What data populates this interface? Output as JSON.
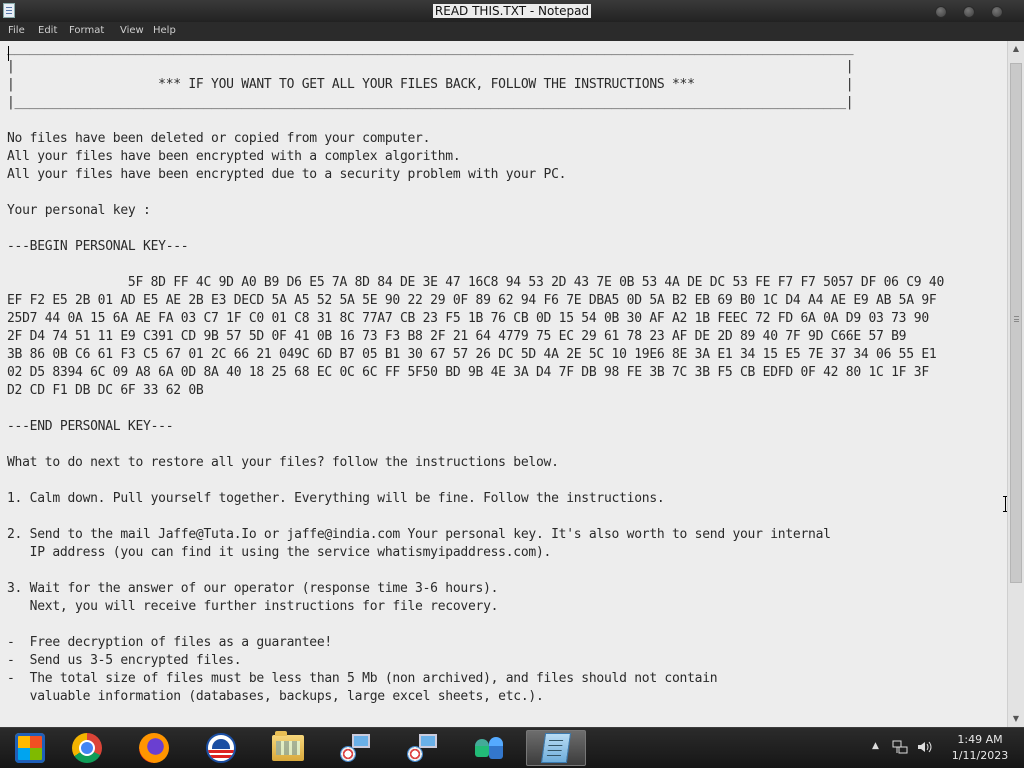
{
  "window": {
    "title": "READ THIS.TXT - Notepad",
    "icon": "notepad-icon"
  },
  "menu": [
    "File",
    "Edit",
    "Format",
    "View",
    "Help"
  ],
  "document": {
    "lines": [
      "________________________________________________________________________________________________________________",
      "|                                                                                                              |",
      "|                   *** IF YOU WANT TO GET ALL YOUR FILES BACK, FOLLOW THE INSTRUCTIONS ***                    |",
      "|______________________________________________________________________________________________________________|",
      "",
      "No files have been deleted or copied from your computer.",
      "All your files have been encrypted with a complex algorithm.",
      "All your files have been encrypted due to a security problem with your PC.",
      "",
      "Your personal key :",
      "",
      "---BEGIN PERSONAL KEY---",
      "",
      "                5F 8D FF 4C 9D A0 B9 D6 E5 7A 8D 84 DE 3E 47 16C8 94 53 2D 43 7E 0B 53 4A DE DC 53 FE F7 F7 5057 DF 06 C9 40",
      "EF F2 E5 2B 01 AD E5 AE 2B E3 DECD 5A A5 52 5A 5E 90 22 29 0F 89 62 94 F6 7E DBA5 0D 5A B2 EB 69 B0 1C D4 A4 AE E9 AB 5A 9F",
      "25D7 44 0A 15 6A AE FA 03 C7 1F C0 01 C8 31 8C 77A7 CB 23 F5 1B 76 CB 0D 15 54 0B 30 AF A2 1B FEEC 72 FD 6A 0A D9 03 73 90",
      "2F D4 74 51 11 E9 C391 CD 9B 57 5D 0F 41 0B 16 73 F3 B8 2F 21 64 4779 75 EC 29 61 78 23 AF DE 2D 89 40 7F 9D C66E 57 B9",
      "3B 86 0B C6 61 F3 C5 67 01 2C 66 21 049C 6D B7 05 B1 30 67 57 26 DC 5D 4A 2E 5C 10 19E6 8E 3A E1 34 15 E5 7E 37 34 06 55 E1",
      "02 D5 8394 6C 09 A8 6A 0D 8A 40 18 25 68 EC 0C 6C FF 5F50 BD 9B 4E 3A D4 7F DB 98 FE 3B 7C 3B F5 CB EDFD 0F 42 80 1C 1F 3F",
      "D2 CD F1 DB DC 6F 33 62 0B",
      "",
      "---END PERSONAL KEY---",
      "",
      "What to do next to restore all your files? follow the instructions below.",
      "",
      "1. Calm down. Pull yourself together. Everything will be fine. Follow the instructions.",
      "",
      "2. Send to the mail Jaffe@Tuta.Io or jaffe@india.com Your personal key. It's also worth to send your internal",
      "   IP address (you can find it using the service whatismyipaddress.com).",
      "",
      "3. Wait for the answer of our operator (response time 3-6 hours).",
      "   Next, you will receive further instructions for file recovery.",
      "",
      "-  Free decryption of files as a guarantee!",
      "-  Send us 3-5 encrypted files.",
      "-  The total size of files must be less than 5 Mb (non archived), and files should not contain",
      "   valuable information (databases, backups, large excel sheets, etc.)."
    ]
  },
  "taskbar": {
    "items": [
      {
        "name": "start-button-icon"
      },
      {
        "name": "chrome-icon"
      },
      {
        "name": "firefox-icon"
      },
      {
        "name": "campaign-logo-icon"
      },
      {
        "name": "file-explorer-icon"
      },
      {
        "name": "network-setup-icon"
      },
      {
        "name": "network-setup-icon-2"
      },
      {
        "name": "users-icon"
      },
      {
        "name": "notepad-icon"
      }
    ],
    "tray": [
      "chevron-up-icon",
      "network-icon",
      "volume-icon"
    ],
    "clock": {
      "time": "1:49 AM",
      "date": "1/11/2023"
    }
  }
}
